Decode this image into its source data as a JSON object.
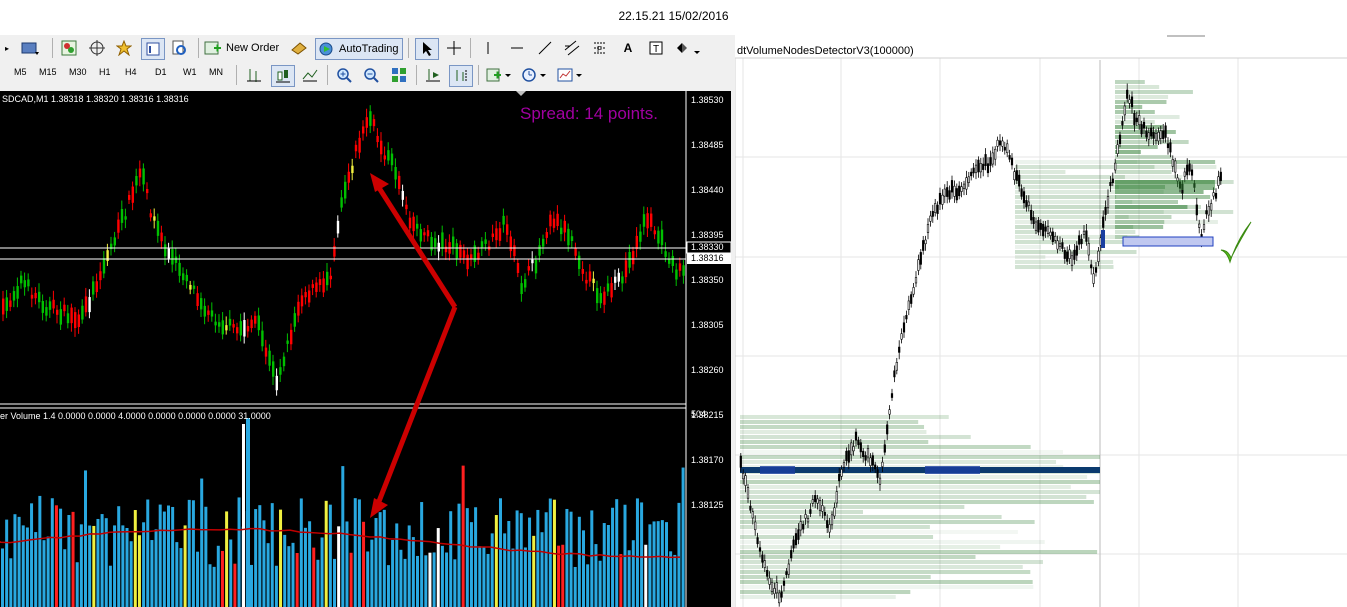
{
  "header": {
    "timestamp": "22.15.21 15/02/2016"
  },
  "toolbar": {
    "new_order_label": "New Order",
    "autotrading_label": "AutoTrading",
    "timeframes": [
      "M5",
      "M15",
      "M30",
      "H1",
      "H4",
      "D1",
      "W1",
      "MN"
    ],
    "icons": [
      "chart-window-icon",
      "profiles-icon",
      "market-watch-icon",
      "navigator-icon",
      "favorites-icon",
      "data-window-icon",
      "strategy-tester-icon",
      "new-order-icon",
      "expert-icon",
      "autotrading-icon",
      "cursor-icon",
      "crosshair-icon",
      "vertical-line-icon",
      "horizontal-line-icon",
      "trendline-icon",
      "channel-icon",
      "fibonacci-icon",
      "text-icon",
      "label-icon",
      "shapes-icon",
      "bar-chart-icon",
      "candles-icon",
      "line-chart-icon",
      "zoom-in-icon",
      "zoom-out-icon",
      "tile-icon",
      "autoscroll-icon",
      "chart-shift-icon",
      "indicators-icon",
      "periods-icon",
      "templates-icon"
    ]
  },
  "left_chart": {
    "symbol_info": "SDCAD,M1  1.38318 1.38320 1.38316 1.38316",
    "spread_text": "Spread: 14 points.",
    "price_labels": [
      "1.38530",
      "1.38485",
      "1.38440",
      "1.38395",
      "1.38350",
      "1.38305",
      "1.38260",
      "1.38215",
      "1.38170",
      "1.38125"
    ],
    "line_labels": [
      "1.38330",
      "1.38316"
    ],
    "volume_info": "er Volume 1.4 0.0000 0.0000 4.0000 0.0000 0.0000 0.0000 31.0000",
    "volume_max_label": "504",
    "colors": {
      "background": "#000000",
      "bull": "#00c000",
      "bear": "#ff0000",
      "volume": "#29a8e0",
      "volume_ma": "#c00000",
      "arrow": "#cc0000",
      "spread": "#a000a0"
    }
  },
  "right_chart": {
    "indicator_label": "dtVolumeNodesDetectorV3(100000)",
    "colors": {
      "profile": "#2e7d32",
      "poc": "#0b3a6e",
      "highlight_fill": "#c0c8f0",
      "checkmark": "#5cc020"
    }
  }
}
